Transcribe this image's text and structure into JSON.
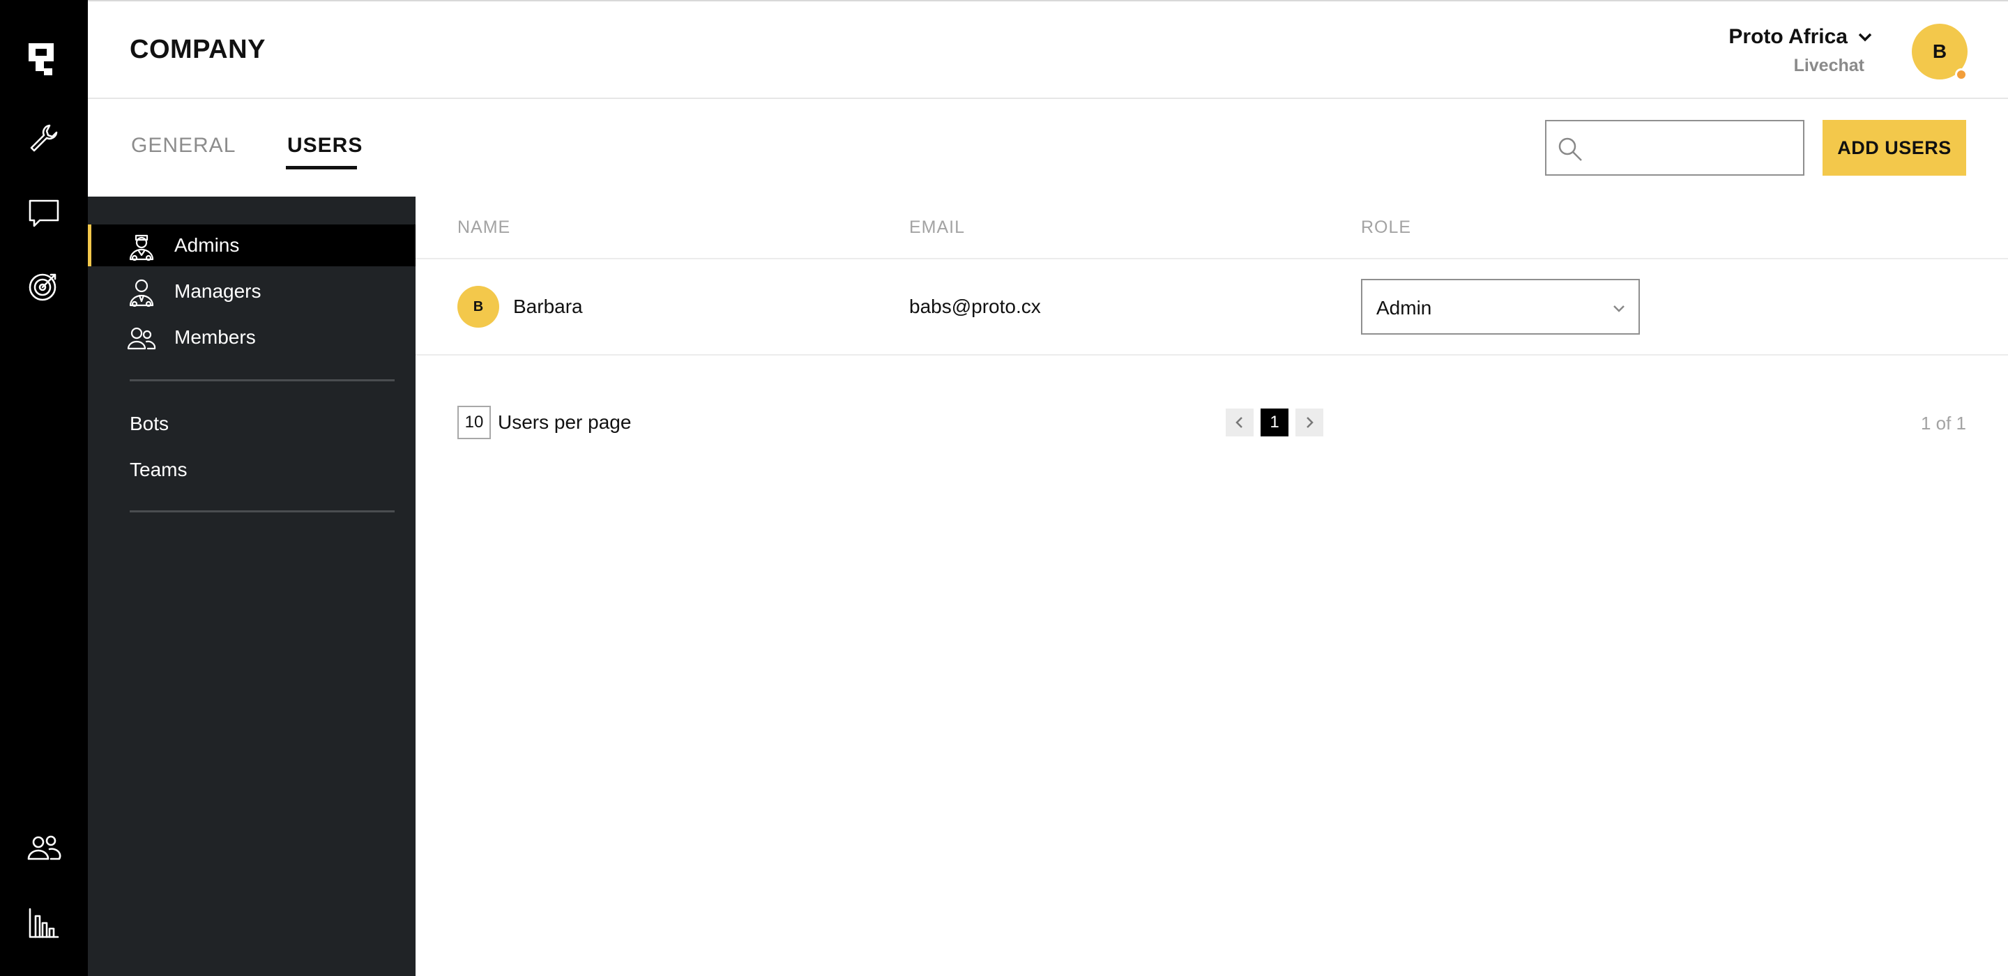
{
  "header": {
    "title": "COMPANY",
    "org_name": "Proto Africa",
    "org_sub": "Livechat",
    "avatar_initial": "B"
  },
  "rail": {
    "icons": [
      "logo-icon",
      "wrench-icon",
      "chat-icon",
      "target-icon",
      "users-icon",
      "bar-chart-icon"
    ]
  },
  "tabs": [
    {
      "label": "GENERAL",
      "active": false
    },
    {
      "label": "USERS",
      "active": true
    }
  ],
  "search": {
    "placeholder": ""
  },
  "add_button": "ADD USERS",
  "subnav": {
    "roles": [
      {
        "label": "Admins",
        "icon": "admin-icon",
        "active": true
      },
      {
        "label": "Managers",
        "icon": "manager-icon",
        "active": false
      },
      {
        "label": "Members",
        "icon": "members-icon",
        "active": false
      }
    ],
    "other": [
      {
        "label": "Bots"
      },
      {
        "label": "Teams"
      }
    ]
  },
  "table": {
    "headers": [
      "NAME",
      "EMAIL",
      "ROLE"
    ],
    "rows": [
      {
        "initial": "B",
        "name": "Barbara",
        "email": "babs@proto.cx",
        "role": "Admin"
      }
    ]
  },
  "pagination": {
    "per_page": "10",
    "per_page_label": "Users per page",
    "current_page": "1",
    "count": "1 of 1"
  },
  "colors": {
    "accent": "#f3c84b",
    "rail": "#000000",
    "subnav": "#202326",
    "presence": "#f29e3a"
  }
}
